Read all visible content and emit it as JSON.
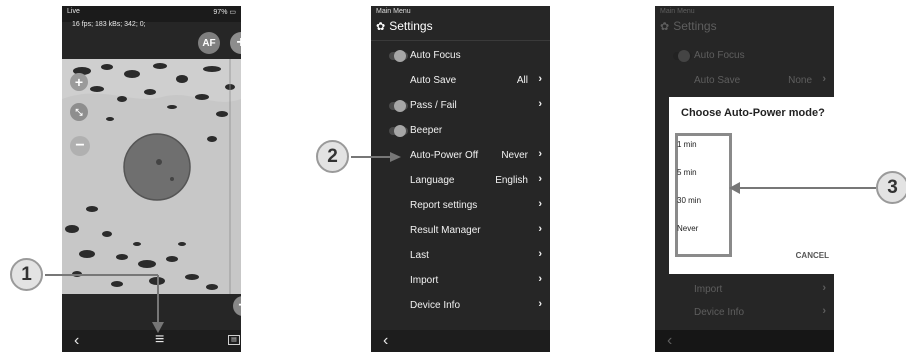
{
  "phone1": {
    "status_left": "Live",
    "status_right": "97%",
    "stats": "16 fps; 183 kBs; 342; 0;",
    "af_label": "AF",
    "plus_glyph": "+",
    "icons": [
      "plus-icon",
      "fit-icon",
      "minus-icon",
      "back-icon",
      "menu-icon",
      "report-icon"
    ]
  },
  "phone2": {
    "header": "Main Menu",
    "title": "Settings",
    "rows": [
      {
        "label": "Auto Focus",
        "value": "",
        "toggle": true,
        "chevron": false
      },
      {
        "label": "Auto Save",
        "value": "All",
        "toggle": false,
        "chevron": true
      },
      {
        "label": "Pass / Fail",
        "value": "",
        "toggle": true,
        "chevron": true
      },
      {
        "label": "Beeper",
        "value": "",
        "toggle": true,
        "chevron": false
      },
      {
        "label": "Auto-Power Off",
        "value": "Never",
        "toggle": false,
        "chevron": true
      },
      {
        "label": "Language",
        "value": "English",
        "toggle": false,
        "chevron": true
      },
      {
        "label": "Report settings",
        "value": "",
        "toggle": false,
        "chevron": true
      },
      {
        "label": "Result Manager",
        "value": "",
        "toggle": false,
        "chevron": true
      },
      {
        "label": "Last",
        "value": "",
        "toggle": false,
        "chevron": true
      },
      {
        "label": "Import",
        "value": "",
        "toggle": false,
        "chevron": true
      },
      {
        "label": "Device Info",
        "value": "",
        "toggle": false,
        "chevron": true
      }
    ]
  },
  "phone3": {
    "header": "Main Menu",
    "title": "Settings",
    "bg_rows": [
      {
        "label": "Auto Focus",
        "value": ""
      },
      {
        "label": "Auto Save",
        "value": "None"
      },
      {
        "label": "Import",
        "value": ""
      },
      {
        "label": "Device Info",
        "value": ""
      }
    ],
    "dialog": {
      "title": "Choose Auto-Power mode?",
      "options": [
        "1 min",
        "5 min",
        "30 min",
        "Never"
      ],
      "cancel": "CANCEL"
    }
  },
  "callouts": [
    "1",
    "2",
    "3"
  ]
}
